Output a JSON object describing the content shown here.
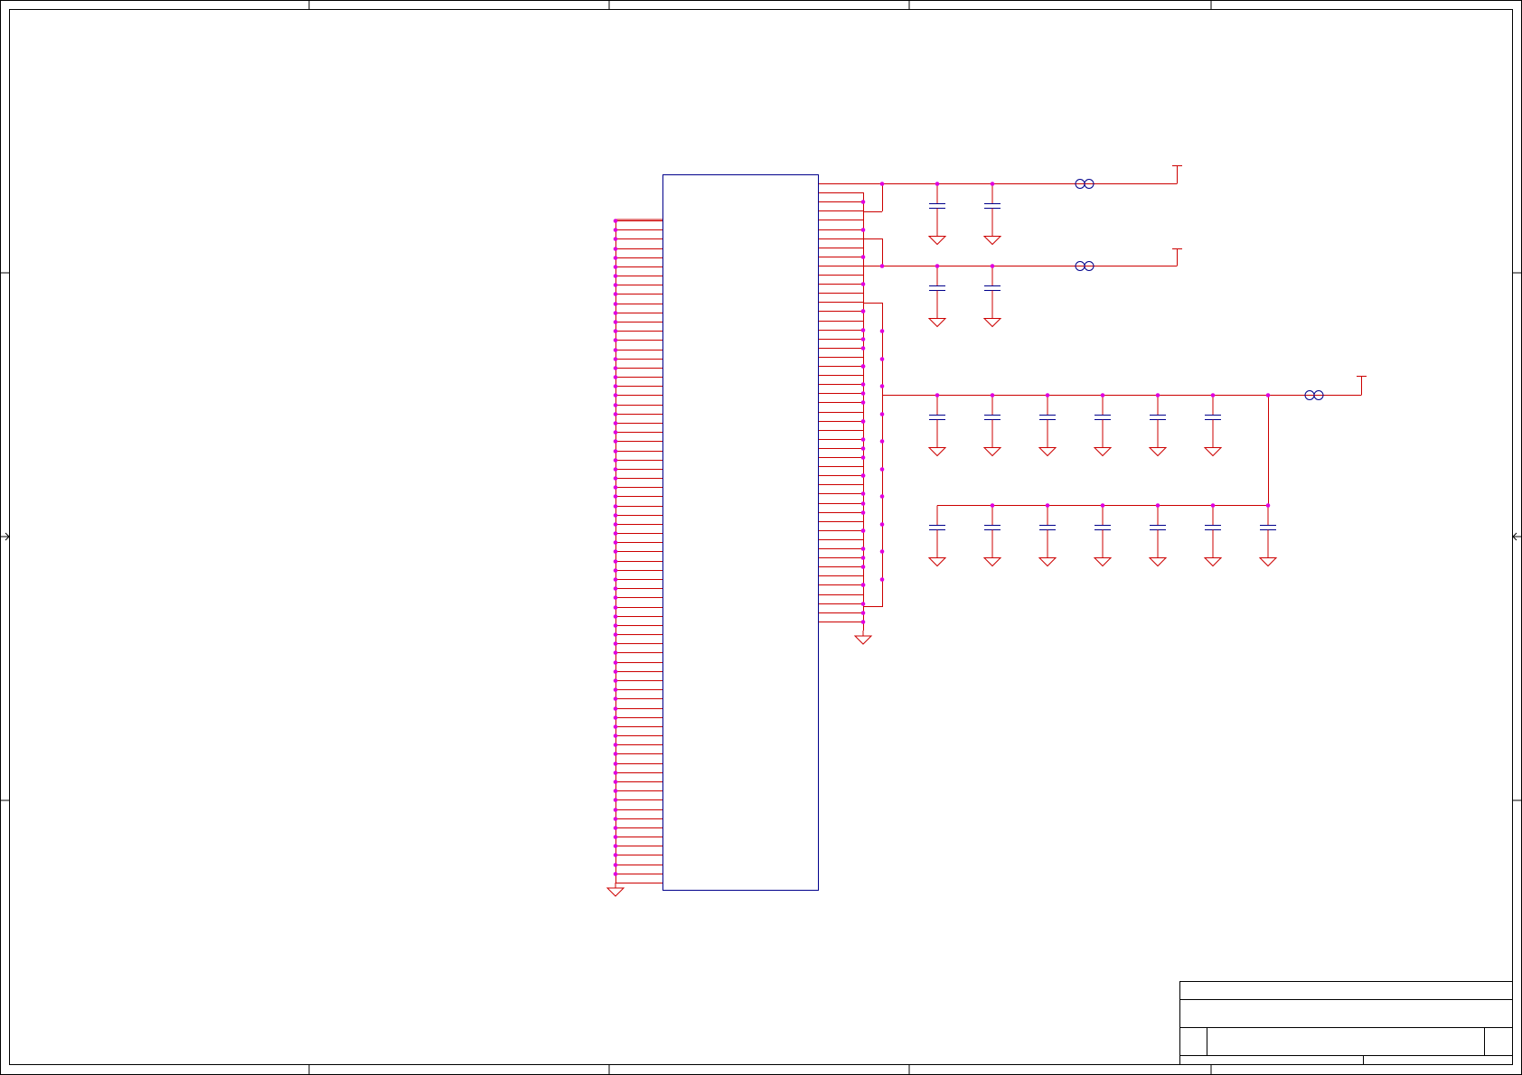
{
  "sheet": {
    "border_color": "#000000",
    "wire_color": "#cc0000",
    "component_color": "#00008b",
    "junction_color": "#e000e0",
    "background": "#ffffff"
  },
  "ic": {
    "left_pin_count": 72,
    "right_pin_count": 49
  },
  "supply_rails": [
    {
      "capacitor_count": 2,
      "has_ferrite_bead": true,
      "has_power_port": true
    },
    {
      "capacitor_count": 2,
      "has_ferrite_bead": true,
      "has_power_port": true
    },
    {
      "capacitor_count": 13,
      "has_ferrite_bead": true,
      "has_power_port": true
    }
  ],
  "ground_symbols": 20,
  "title_block": {
    "title": "",
    "size": "",
    "number": "",
    "revision": "",
    "date": "",
    "sheet": ""
  }
}
